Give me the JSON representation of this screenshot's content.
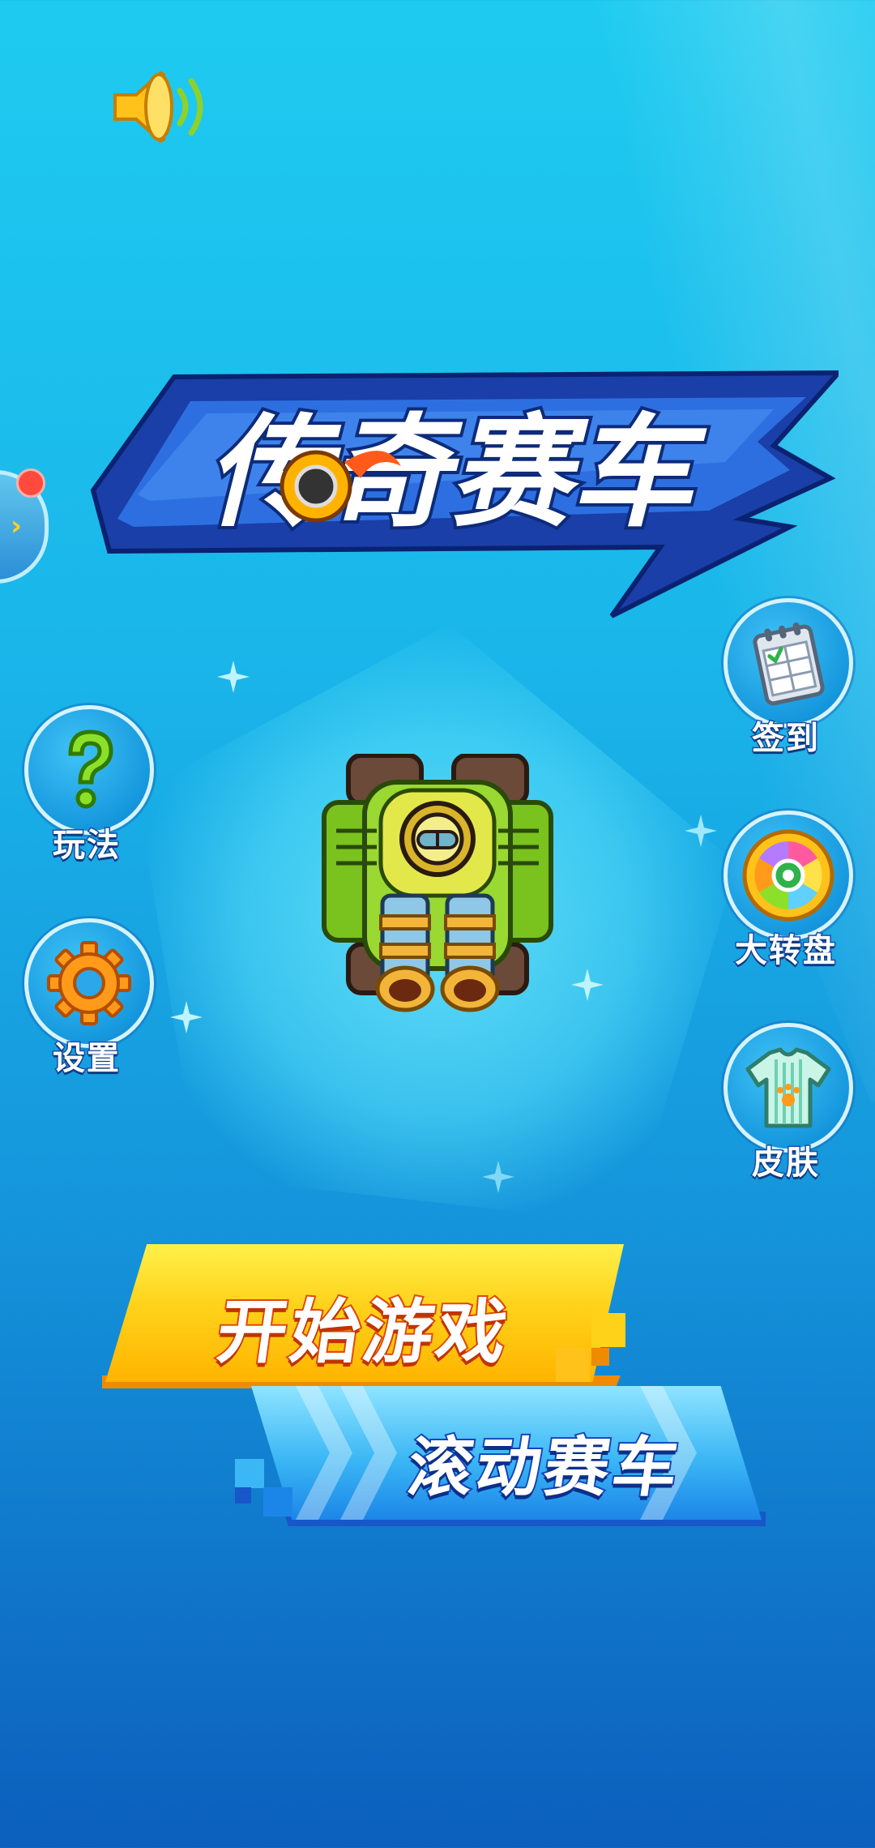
{
  "title": "传奇赛车",
  "side_buttons_left": [
    {
      "id": "rules",
      "label": "玩法",
      "icon": "question-mark-icon"
    },
    {
      "id": "settings",
      "label": "设置",
      "icon": "gear-icon"
    }
  ],
  "side_buttons_right": [
    {
      "id": "checkin",
      "label": "签到",
      "icon": "calendar-checklist-icon"
    },
    {
      "id": "wheel",
      "label": "大转盘",
      "icon": "prize-wheel-icon"
    },
    {
      "id": "skin",
      "label": "皮肤",
      "icon": "tshirt-icon"
    }
  ],
  "main_buttons": {
    "start": "开始游戏",
    "rolling": "滚动赛车"
  },
  "colors": {
    "start_button": "#ffd21a",
    "rolling_button": "#3bb7f5",
    "background_top": "#1ecbf0",
    "background_bottom": "#0c5fbd"
  }
}
